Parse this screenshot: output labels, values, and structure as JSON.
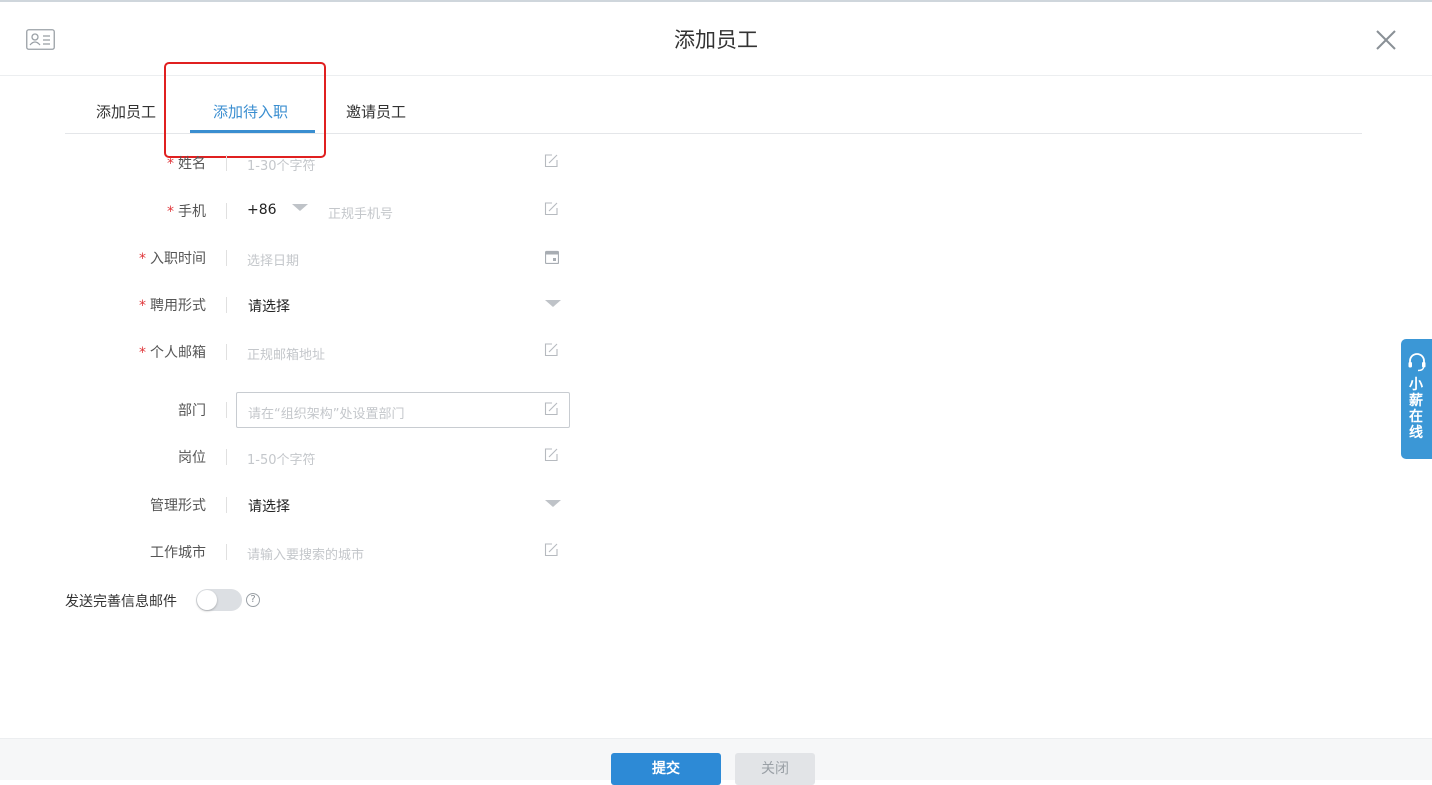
{
  "header": {
    "title": "添加员工"
  },
  "tabs": [
    {
      "label": "添加员工",
      "active": false
    },
    {
      "label": "添加待入职",
      "active": true
    },
    {
      "label": "邀请员工",
      "active": false
    }
  ],
  "form": {
    "name": {
      "label": "姓名",
      "required_mark": "*",
      "placeholder": "1-30个字符"
    },
    "phone": {
      "label": "手机",
      "required_mark": "*",
      "country_code": "+86",
      "placeholder": "正规手机号"
    },
    "onboard_date": {
      "label": "入职时间",
      "required_mark": "*",
      "placeholder": "选择日期"
    },
    "employment_type": {
      "label": "聘用形式",
      "required_mark": "*",
      "value": "请选择"
    },
    "email": {
      "label": "个人邮箱",
      "required_mark": "*",
      "placeholder": "正规邮箱地址"
    },
    "department": {
      "label": "部门",
      "placeholder": "请在“组织架构”处设置部门"
    },
    "position": {
      "label": "岗位",
      "placeholder": "1-50个字符"
    },
    "management_type": {
      "label": "管理形式",
      "value": "请选择"
    },
    "work_city": {
      "label": "工作城市",
      "placeholder": "请输入要搜索的城市"
    }
  },
  "send_info_email": {
    "label": "发送完善信息邮件",
    "enabled": false,
    "help": "?"
  },
  "side_widget": {
    "label": "小薪在线"
  },
  "footer": {
    "submit": "提交",
    "close": "关闭"
  },
  "colors": {
    "accent": "#3a8ed0",
    "required": "#e0363a",
    "highlight": "#e02020",
    "side_widget": "#3b97d6"
  }
}
